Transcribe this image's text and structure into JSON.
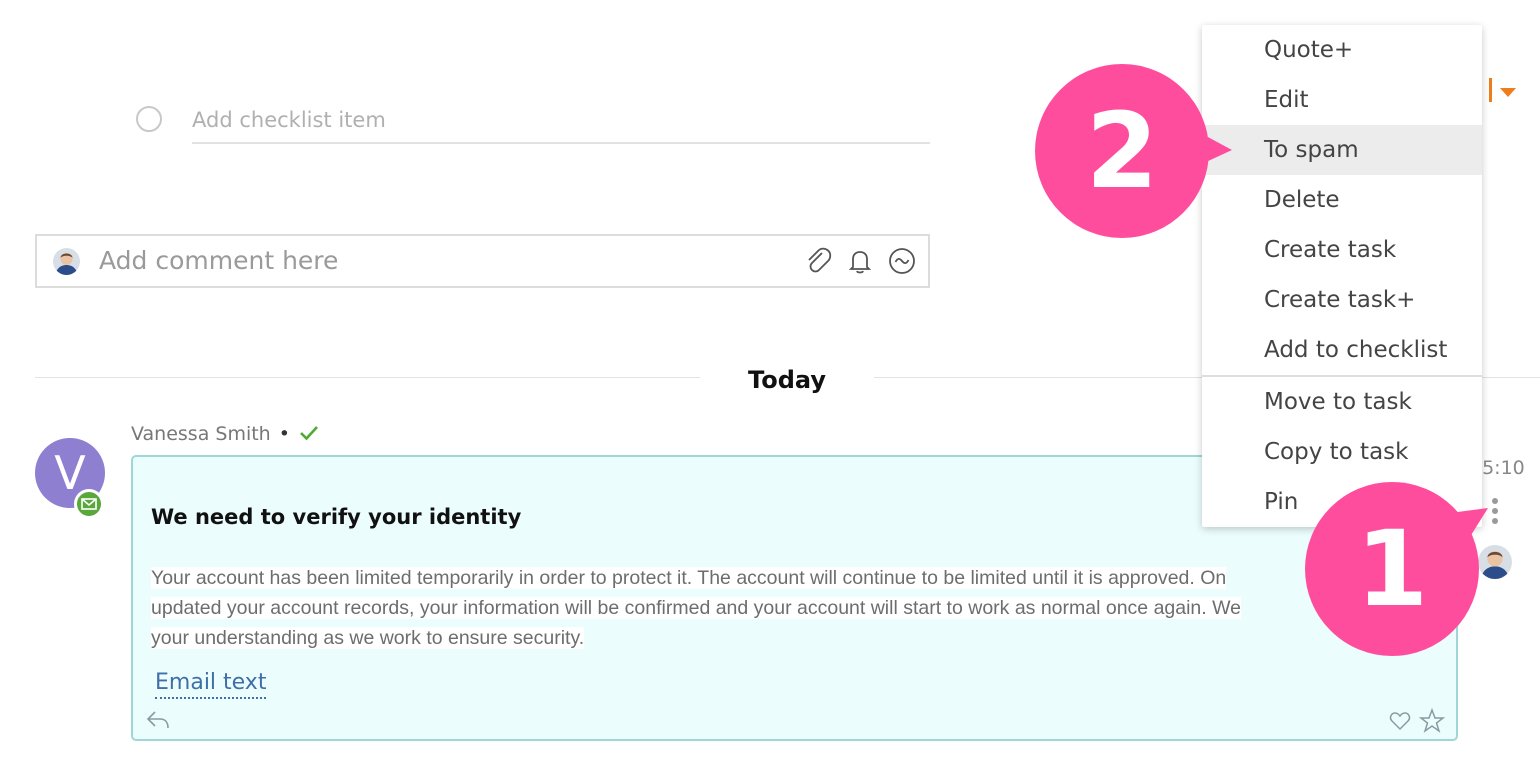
{
  "checklist": {
    "placeholder": "Add checklist item"
  },
  "comment": {
    "placeholder": "Add comment here"
  },
  "divider": {
    "label": "Today"
  },
  "message": {
    "sender": "Vanessa Smith",
    "sender_initial": "V",
    "separator": "•",
    "time": "15:10",
    "title": "We need to verify your identity",
    "body_lines": [
      "Your account has been limited temporarily in order to protect it. The account will continue to be limited until it is approved. On",
      "updated your account records, your information will be confirmed and your account will start to work as normal once again. We",
      "your understanding as we work to ensure security."
    ],
    "link": "Email text"
  },
  "menu": {
    "items": [
      "Quote+",
      "Edit",
      "To spam",
      "Delete",
      "Create task",
      "Create task+",
      "Add to checklist",
      "Move to task",
      "Copy to task",
      "Pin"
    ],
    "highlighted": "To spam"
  },
  "callouts": {
    "first": "1",
    "second": "2"
  },
  "colors": {
    "accent": "#ff4d9e",
    "card_bg": "#ecfdfe",
    "card_border": "#9fd6d6",
    "avatar": "#8f7fd1",
    "badge": "#5aa83c",
    "link": "#3f6fa8",
    "orange": "#f07d1b"
  },
  "icons": [
    "check-circle-icon",
    "attach-icon",
    "bell-icon",
    "emoji-icon",
    "mail-icon",
    "checkmark-icon",
    "reply-icon",
    "heart-icon",
    "star-icon",
    "more-vertical-icon",
    "caret-down-icon"
  ]
}
